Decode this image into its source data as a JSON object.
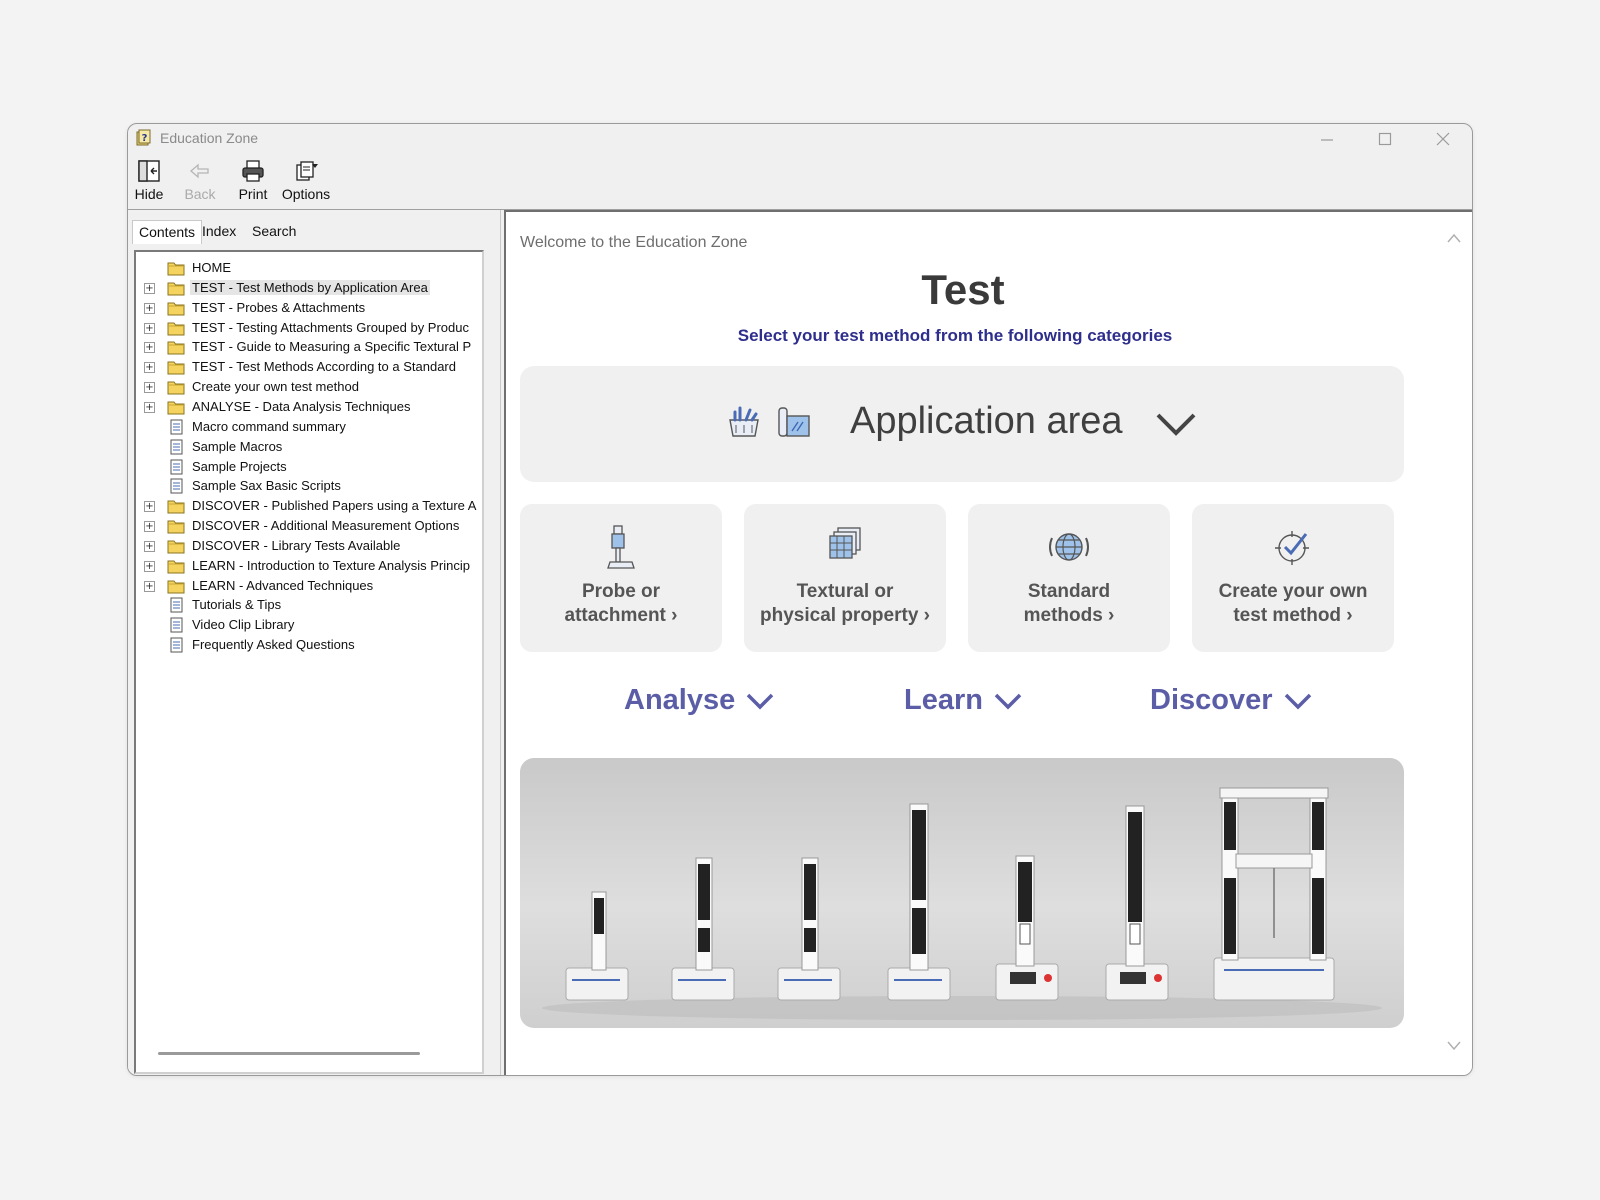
{
  "window": {
    "title": "Education Zone"
  },
  "toolbar": {
    "hide": "Hide",
    "back": "Back",
    "print": "Print",
    "options": "Options"
  },
  "tabs": {
    "contents": "Contents",
    "index": "Index",
    "search": "Search"
  },
  "tree": [
    {
      "label": "HOME",
      "type": "folder",
      "expandable": false
    },
    {
      "label": "TEST - Test Methods by Application Area",
      "type": "folder",
      "expandable": true,
      "selected": true
    },
    {
      "label": "TEST - Probes & Attachments",
      "type": "folder",
      "expandable": true
    },
    {
      "label": "TEST - Testing Attachments Grouped by Produc",
      "type": "folder",
      "expandable": true
    },
    {
      "label": "TEST - Guide to Measuring a Specific Textural P",
      "type": "folder",
      "expandable": true
    },
    {
      "label": "TEST - Test Methods According to a Standard",
      "type": "folder",
      "expandable": true
    },
    {
      "label": "Create your own test method",
      "type": "folder",
      "expandable": true
    },
    {
      "label": "ANALYSE - Data Analysis Techniques",
      "type": "folder",
      "expandable": true
    },
    {
      "label": "Macro command summary",
      "type": "page",
      "expandable": false
    },
    {
      "label": "Sample Macros",
      "type": "page",
      "expandable": false
    },
    {
      "label": "Sample Projects",
      "type": "page",
      "expandable": false
    },
    {
      "label": "Sample Sax Basic Scripts",
      "type": "page",
      "expandable": false
    },
    {
      "label": "DISCOVER - Published Papers using a Texture A",
      "type": "folder",
      "expandable": true
    },
    {
      "label": "DISCOVER - Additional Measurement Options",
      "type": "folder",
      "expandable": true
    },
    {
      "label": "DISCOVER - Library Tests Available",
      "type": "folder",
      "expandable": true
    },
    {
      "label": "LEARN - Introduction to Texture Analysis Princip",
      "type": "folder",
      "expandable": true
    },
    {
      "label": "LEARN - Advanced Techniques",
      "type": "folder",
      "expandable": true
    },
    {
      "label": "Tutorials & Tips",
      "type": "page",
      "expandable": false
    },
    {
      "label": "Video Clip Library",
      "type": "page",
      "expandable": false
    },
    {
      "label": "Frequently Asked Questions",
      "type": "page",
      "expandable": false
    }
  ],
  "content": {
    "welcome": "Welcome to the Education Zone",
    "title": "Test",
    "subtitle": "Select your test method from the following categories",
    "application_area": "Application area",
    "cards": [
      {
        "line1": "Probe or",
        "line2": "attachment ›",
        "icon": "probe-icon"
      },
      {
        "line1": "Textural or",
        "line2": "physical property ›",
        "icon": "layers-icon"
      },
      {
        "line1": "Standard",
        "line2": "methods ›",
        "icon": "globe-icon"
      },
      {
        "line1": "Create your own",
        "line2": "test method ›",
        "icon": "target-check-icon"
      }
    ],
    "menus": {
      "analyse": "Analyse",
      "learn": "Learn",
      "discover": "Discover"
    }
  },
  "colors": {
    "accent": "#5b5ea6",
    "subtitle": "#2e2e8c",
    "card_bg": "#f0f0f0"
  }
}
